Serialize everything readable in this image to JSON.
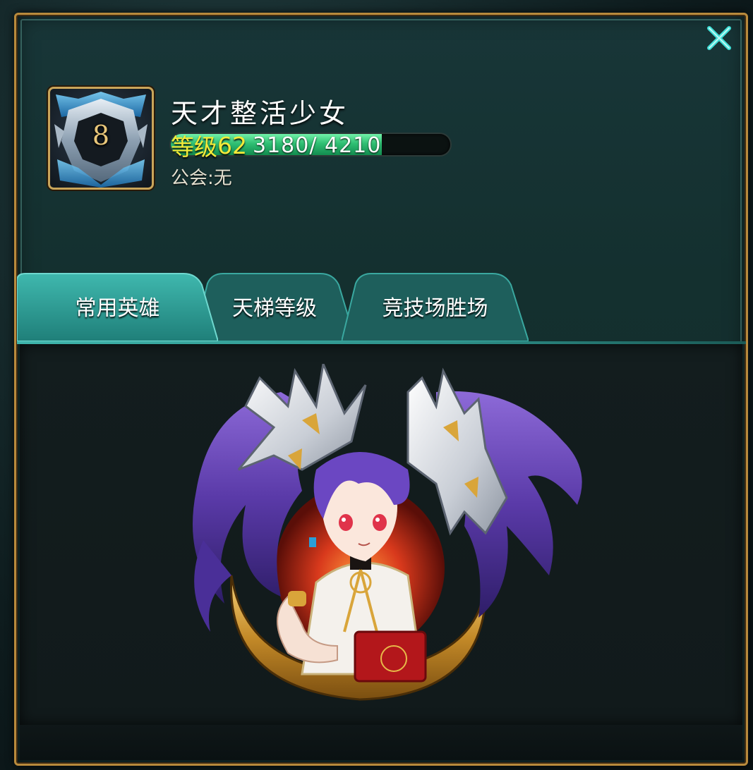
{
  "window": {
    "close_icon": "close-icon",
    "accent_color": "#3fe0d8",
    "frame_color": "#b88a3c"
  },
  "player": {
    "rank_badge_number": "8",
    "name": "天才整活少女",
    "level_label": "等级",
    "level_value": "62",
    "exp_current": 3180,
    "exp_max": 4210,
    "exp_text": "3180/ 4210",
    "exp_fraction": 0.755,
    "guild_text": "公会:无"
  },
  "tabs": [
    {
      "label": "常用英雄",
      "active": true
    },
    {
      "label": "天梯等级",
      "active": false
    },
    {
      "label": "竞技场胜场",
      "active": false
    }
  ],
  "content": {
    "hero_portrait_icon": "purple-haired-hero-portrait"
  },
  "colors": {
    "level_text": "#f2ea3a",
    "exp_bar_fill": "#2fbf73",
    "tab_active": "#2a8c86",
    "tab_inactive": "#1e5f5c"
  }
}
